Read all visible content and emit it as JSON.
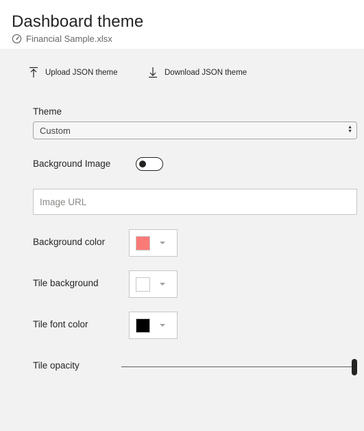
{
  "header": {
    "title": "Dashboard theme",
    "subtitle": "Financial Sample.xlsx",
    "subtitle_icon": "gauge-icon"
  },
  "actions": {
    "upload_label": "Upload JSON theme",
    "upload_icon": "upload-arrow-icon",
    "download_label": "Download JSON theme",
    "download_icon": "download-arrow-icon"
  },
  "theme": {
    "label": "Theme",
    "selected": "Custom"
  },
  "background_image": {
    "label": "Background Image",
    "enabled": false
  },
  "image_url": {
    "placeholder": "Image URL",
    "value": ""
  },
  "background_color": {
    "label": "Background color",
    "color": "#fa7a78"
  },
  "tile_background": {
    "label": "Tile background",
    "color": "#ffffff"
  },
  "tile_font_color": {
    "label": "Tile font color",
    "color": "#000000"
  },
  "tile_opacity": {
    "label": "Tile opacity",
    "value_fraction": 1.0
  }
}
